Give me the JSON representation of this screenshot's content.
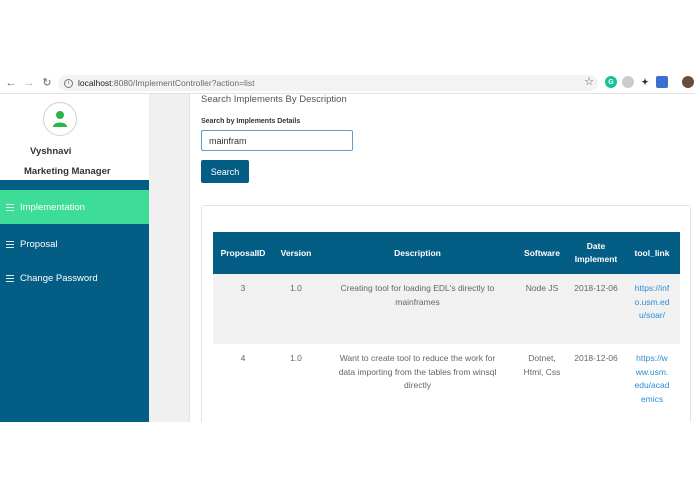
{
  "browser": {
    "url_host": "localhost",
    "url_path": ":8080/ImplementController?action=list",
    "back_icon": "back-arrow-icon",
    "forward_icon": "forward-arrow-icon",
    "reload_icon": "reload-icon"
  },
  "sidebar": {
    "user_name": "Vyshnavi",
    "user_role": "Marketing Manager",
    "items": [
      {
        "label": "Implementation",
        "active": true
      },
      {
        "label": "Proposal",
        "active": false
      },
      {
        "label": "Change Password",
        "active": false
      }
    ]
  },
  "main": {
    "title": "Search Implements By Description",
    "search_label": "Search by Implements Details",
    "search_value": "mainfram",
    "search_button": "Search"
  },
  "table": {
    "headers": [
      "ProposalID",
      "Version",
      "Description",
      "Software",
      "Date Implement",
      "tool_link"
    ],
    "rows": [
      {
        "proposal_id": "3",
        "version": "1.0",
        "description": "Creating tool for loading EDL's directly to mainframes",
        "software": "Node JS",
        "date": "2018-12-06",
        "tool_link": "https://info.usm.edu/soar/"
      },
      {
        "proposal_id": "4",
        "version": "1.0",
        "description": "Want to create tool to reduce the work for data importing from the tables from winsql directly",
        "software": "Dotnet, Html, Css",
        "date": "2018-12-06",
        "tool_link": "https://www.usm.edu/academics"
      }
    ]
  },
  "colors": {
    "nav_bg": "#045d85",
    "active_bg": "#3ddc97",
    "link": "#2a8ed6"
  }
}
